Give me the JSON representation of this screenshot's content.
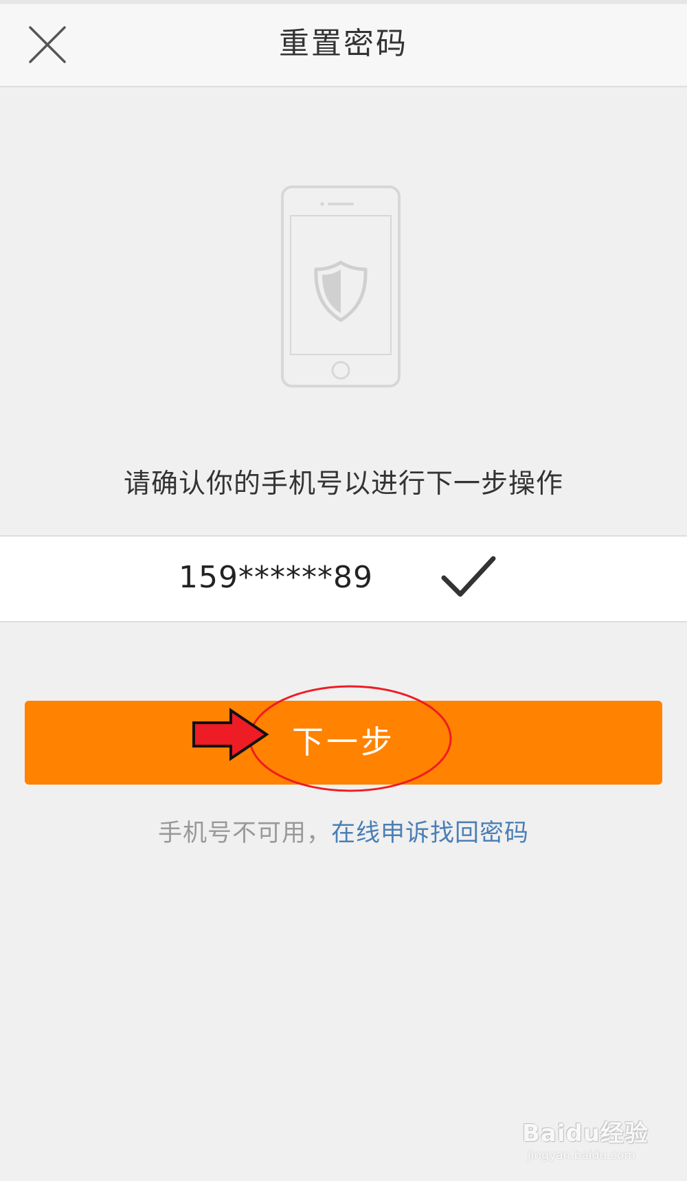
{
  "header": {
    "title": "重置密码",
    "close_icon": "close-icon"
  },
  "illustration": {
    "icon": "phone-shield-icon"
  },
  "confirm": {
    "message": "请确认你的手机号以进行下一步操作",
    "phone_number": "159******89",
    "check_icon": "checkmark-icon"
  },
  "actions": {
    "next_label": "下一步",
    "button_color": "#ff8200"
  },
  "help": {
    "static_text": "手机号不可用，",
    "link_text": "在线申诉找回密码",
    "link_color": "#4a7fb5"
  },
  "annotations": {
    "arrow_color": "#ee1c25",
    "ellipse_color": "#ee1c25"
  },
  "watermark": {
    "brand": "Baidu经验",
    "url": "jingyan.baidu.com"
  }
}
